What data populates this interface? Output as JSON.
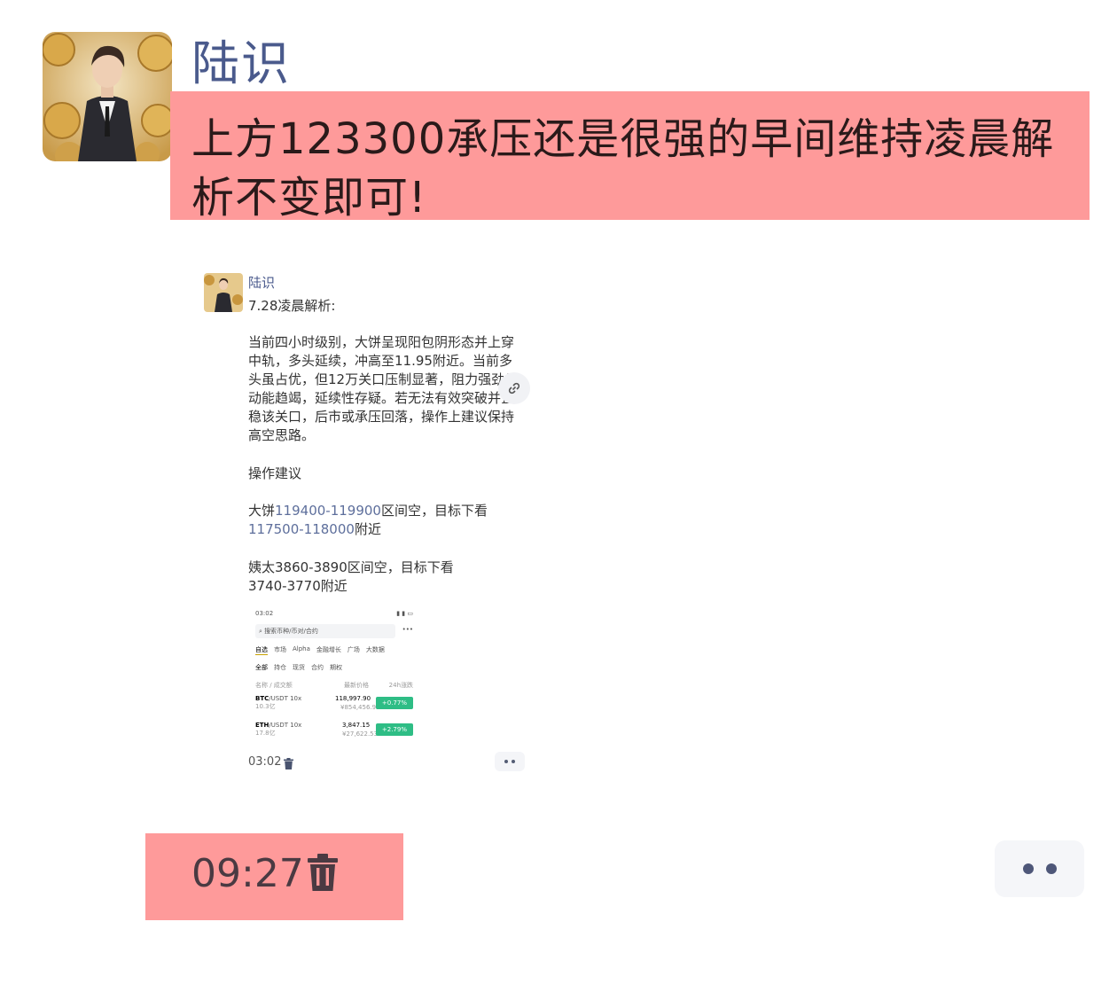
{
  "message": {
    "sender_name": "陆识",
    "text": "上方123300承压还是很强的早间维持凌晨解析不变即可!",
    "time": "09:27"
  },
  "quoted": {
    "sender_name": "陆识",
    "title": "7.28凌晨解析:",
    "paragraph": "当前四小时级别，大饼呈现阳包阴形态并上穿中轨，多头延续，冲高至11.95附近。当前多头虽占优，但12万关口压制显著，阻力强劲且动能趋竭，延续性存疑。若无法有效突破并企稳该关口，后市或承压回落，操作上建议保持高空思路。",
    "ops_heading": "操作建议",
    "btc_prefix": "大饼",
    "btc_range": "119400-119900",
    "btc_mid": "区间空，目标下看",
    "btc_target": "117500-118000",
    "btc_suffix": "附近",
    "eth_line1": "姨太3860-3890区间空，目标下看",
    "eth_line2": "3740-3770附近",
    "time": "03:02",
    "phone": {
      "status_time": "03:02",
      "search_placeholder": "搜索币种/币对/合约",
      "tabs": [
        "自选",
        "市场",
        "Alpha",
        "金融增长",
        "广场",
        "大数据"
      ],
      "subtabs": [
        "全部",
        "持仓",
        "现货",
        "合约",
        "期权"
      ],
      "col_left": "名称 / 成交额",
      "col_mid": "最新价格",
      "col_right": "24h涨跌",
      "rows": [
        {
          "symbol": "BTC",
          "pair": "/USDT",
          "lev": "10x",
          "vol": "10.3亿",
          "price": "118,997.90",
          "cny": "¥854,456.92",
          "change": "+0.77%"
        },
        {
          "symbol": "ETH",
          "pair": "/USDT",
          "lev": "10x",
          "vol": "17.8亿",
          "price": "3,847.15",
          "cny": "¥27,622.53",
          "change": "+2.79%"
        }
      ]
    }
  },
  "colors": {
    "highlight": "#fe9a9a",
    "name_blue": "#4a5a8c",
    "green_chip": "#2ebd85"
  }
}
